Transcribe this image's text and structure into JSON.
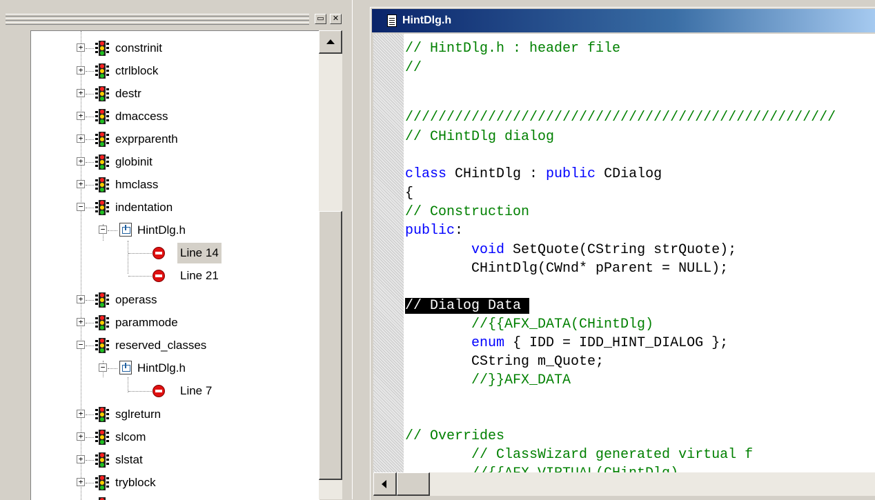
{
  "tree": {
    "items": [
      {
        "label": "constrinit"
      },
      {
        "label": "ctrlblock"
      },
      {
        "label": "destr"
      },
      {
        "label": "dmaccess"
      },
      {
        "label": "exprparenth"
      },
      {
        "label": "globinit"
      },
      {
        "label": "hmclass"
      },
      {
        "label": "indentation"
      },
      {
        "label": "HintDlg.h"
      },
      {
        "label": "Line 14"
      },
      {
        "label": "Line 21"
      },
      {
        "label": "operass"
      },
      {
        "label": "parammode"
      },
      {
        "label": "reserved_classes"
      },
      {
        "label": "HintDlg.h"
      },
      {
        "label": "Line 7"
      },
      {
        "label": "sglreturn"
      },
      {
        "label": "slcom"
      },
      {
        "label": "slstat"
      },
      {
        "label": "tryblock"
      }
    ]
  },
  "editor": {
    "title": "HintDlg.h",
    "lines": [
      "// HintDlg.h : header file",
      "//",
      "",
      "",
      "////////////////////////////////////////////////////",
      "// CHintDlg dialog",
      "",
      "class",
      " CHintDlg : ",
      "public",
      " CDialog",
      "{",
      "// Construction",
      "public",
      ":",
      "        ",
      "void",
      " SetQuote(CString strQuote);",
      "        CHintDlg(CWnd* pParent = NULL);",
      "",
      "// Dialog Data ",
      "        //{{AFX_DATA(CHintDlg)",
      "        ",
      "enum",
      " { IDD = IDD_HINT_DIALOG };",
      "        CString m_Quote;",
      "        //}}AFX_DATA",
      "// Overrides",
      "        // ClassWizard generated virtual f",
      "        //{{AFX_VIRTUAL(CHintDlg)"
    ]
  },
  "colors": {
    "comment": "#008000",
    "keyword": "#0000ff",
    "title_bar": "#0a246a"
  }
}
